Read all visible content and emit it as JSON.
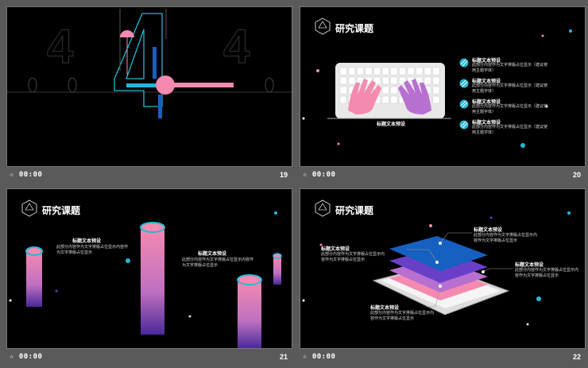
{
  "slides": [
    {
      "number": "19",
      "time": "00:00"
    },
    {
      "number": "20",
      "time": "00:00",
      "title": "研究课题",
      "keyboard_caption": "标题文本预设",
      "items": [
        {
          "heading": "标题文本预设",
          "body": "此部分内容作为文字排版占位显示（建议使用主题字体）"
        },
        {
          "heading": "标题文本预设",
          "body": "此部分内容作为文字排版占位显示（建议使用主题字体）"
        },
        {
          "heading": "标题文本预设",
          "body": "此部分内容作为文字排版占位显示（建议使用主题字体）"
        },
        {
          "heading": "标题文本预设",
          "body": "此部分内容作为文字排版占位显示（建议使用主题字体）"
        }
      ]
    },
    {
      "number": "21",
      "time": "00:00",
      "title": "研究课题",
      "labels": [
        {
          "heading": "标题文本预设",
          "body": "此部分内容作为文字排版占位显示内容作为文字排版占位显示"
        },
        {
          "heading": "标题文本预设",
          "body": "此部分内容作为文字排版占位显示内容作为文字排版占位显示"
        }
      ]
    },
    {
      "number": "22",
      "time": "00:00",
      "title": "研究课题",
      "labels": [
        {
          "heading": "标题文本预设",
          "body": "此部分内容作为文字排版占位显示内容作为文字排版占位显示"
        },
        {
          "heading": "标题文本预设",
          "body": "此部分内容作为文字排版占位显示内容作为文字排版占位显示"
        },
        {
          "heading": "标题文本预设",
          "body": "此部分内容作为文字排版占位显示内容作为文字排版占位显示"
        },
        {
          "heading": "标题文本预设",
          "body": "此部分内容作为文字排版占位显示内容作为文字排版占位显示"
        }
      ]
    }
  ],
  "slide19_digits": [
    "4",
    "4",
    "4"
  ],
  "colors": {
    "cyan": "#22b8d8",
    "pink": "#f48ab0",
    "purple": "#6a3fc8",
    "blue": "#1560c0",
    "frame": "#777777"
  },
  "icons": {
    "footer": "sparkle-icon",
    "logo": "geodesic-icon"
  }
}
